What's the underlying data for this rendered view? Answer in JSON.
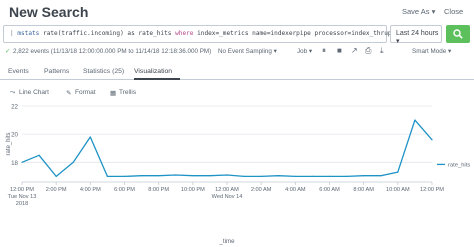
{
  "header": {
    "title": "New Search",
    "save_as_label": "Save As ▾",
    "close_label": "Close"
  },
  "search": {
    "pipe": "|",
    "command": "mstats",
    "part1": "rate(traffic.incoming) as rate_hits",
    "keyword": "where",
    "part2": "index=_metrics name=indexerpipe processor=index_thruput span=1h",
    "time_range": "Last 24 hours ▾"
  },
  "status": {
    "check": "✓",
    "events_text": "2,822 events (11/13/18 12:00:00.000 PM to 11/14/18 12:18:36.000 PM)",
    "sampling_label": "No Event Sampling ▾",
    "job_label": "Job ▾",
    "smart_mode_label": "Smart Mode ▾"
  },
  "tabs": [
    {
      "label": "Events"
    },
    {
      "label": "Patterns"
    },
    {
      "label": "Statistics (25)"
    },
    {
      "label": "Visualization"
    }
  ],
  "viz_toolbar": {
    "line_chart_label": "Line Chart",
    "format_label": "Format",
    "trellis_label": "Trellis"
  },
  "chart_data": {
    "type": "line",
    "ylabel": "rate_hits",
    "xlabel": "_time",
    "ylim": [
      16.6,
      22
    ],
    "yticks": [
      "22",
      "20",
      "18"
    ],
    "xticks": [
      {
        "lines": [
          "12:00 PM",
          "Tue Nov 13",
          "2018"
        ]
      },
      {
        "lines": [
          "2:00 PM"
        ]
      },
      {
        "lines": [
          "4:00 PM"
        ]
      },
      {
        "lines": [
          "6:00 PM"
        ]
      },
      {
        "lines": [
          "8:00 PM"
        ]
      },
      {
        "lines": [
          "10:00 PM"
        ]
      },
      {
        "lines": [
          "12:00 AM",
          "Wed Nov 14"
        ]
      },
      {
        "lines": [
          "2:00 AM"
        ]
      },
      {
        "lines": [
          "4:00 AM"
        ]
      },
      {
        "lines": [
          "6:00 AM"
        ]
      },
      {
        "lines": [
          "8:00 AM"
        ]
      },
      {
        "lines": [
          "10:00 AM"
        ]
      },
      {
        "lines": [
          "12:00 PM"
        ]
      }
    ],
    "series": [
      {
        "name": "rate_hits",
        "x": [
          "12:00 PM",
          "1:00 PM",
          "2:00 PM",
          "3:00 PM",
          "4:00 PM",
          "5:00 PM",
          "6:00 PM",
          "7:00 PM",
          "8:00 PM",
          "9:00 PM",
          "10:00 PM",
          "11:00 PM",
          "12:00 AM",
          "1:00 AM",
          "2:00 AM",
          "3:00 AM",
          "4:00 AM",
          "5:00 AM",
          "6:00 AM",
          "7:00 AM",
          "8:00 AM",
          "9:00 AM",
          "10:00 AM",
          "11:00 AM",
          "12:00 PM"
        ],
        "values": [
          18.0,
          18.5,
          17.0,
          18.0,
          19.8,
          17.0,
          17.0,
          17.05,
          17.05,
          17.1,
          17.05,
          17.05,
          17.1,
          17.0,
          17.0,
          17.05,
          17.0,
          17.0,
          17.0,
          17.0,
          17.05,
          17.05,
          17.3,
          21.0,
          19.6
        ]
      }
    ],
    "legend": "right",
    "colors": {
      "line": "#1e93c6",
      "grid": "#e1e6eb",
      "axis": "#c3cbd4",
      "text": "#5c6773"
    }
  }
}
